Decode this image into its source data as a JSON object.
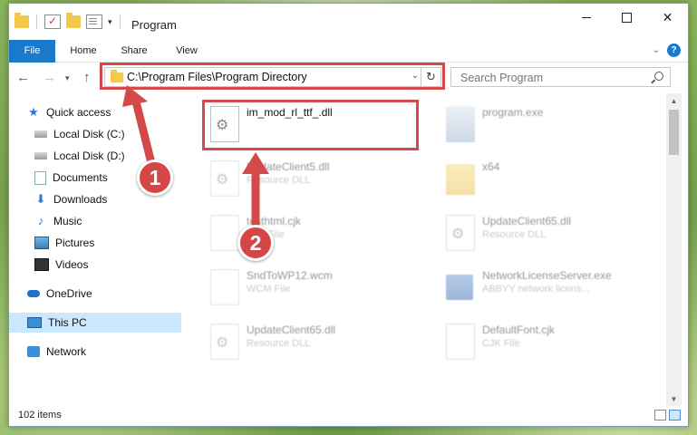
{
  "window": {
    "title": "Program"
  },
  "ribbon": {
    "tabs": [
      "File",
      "Home",
      "Share",
      "View"
    ]
  },
  "address": {
    "path": "C:\\Program Files\\Program Directory"
  },
  "search": {
    "placeholder": "Search Program"
  },
  "sidebar": {
    "items": [
      {
        "label": "Quick access"
      },
      {
        "label": "Local Disk (C:)"
      },
      {
        "label": "Local Disk (D:)"
      },
      {
        "label": "Documents"
      },
      {
        "label": "Downloads"
      },
      {
        "label": "Music"
      },
      {
        "label": "Pictures"
      },
      {
        "label": "Videos"
      },
      {
        "label": "OneDrive"
      },
      {
        "label": "This PC"
      },
      {
        "label": "Network"
      }
    ]
  },
  "files": [
    {
      "name": "im_mod_rl_ttf_.dll",
      "sub": ""
    },
    {
      "name": "program.exe",
      "sub": ""
    },
    {
      "name": "UpdateClient5.dll",
      "sub": "Resource DLL"
    },
    {
      "name": "x64",
      "sub": ""
    },
    {
      "name": "testhtml.cjk",
      "sub": "CJK File"
    },
    {
      "name": "UpdateClient65.dll",
      "sub": "Resource DLL"
    },
    {
      "name": "SndToWP12.wcm",
      "sub": "WCM File"
    },
    {
      "name": "NetworkLicenseServer.exe",
      "sub": "ABBYY network licens..."
    },
    {
      "name": "UpdateClient65.dll",
      "sub": "Resource DLL"
    },
    {
      "name": "DefaultFont.cjk",
      "sub": "CJK File"
    }
  ],
  "status": {
    "count": "102 items"
  },
  "badges": {
    "one": "1",
    "two": "2"
  },
  "colors": {
    "accent": "#1979ca",
    "highlight": "#d44a4a"
  }
}
